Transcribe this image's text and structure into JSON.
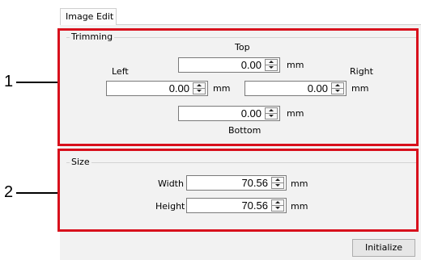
{
  "tab": {
    "label": "Image Edit"
  },
  "callouts": {
    "one": "1",
    "two": "2"
  },
  "trimming": {
    "title": "Trimming",
    "top": {
      "label": "Top",
      "value": "0.00",
      "unit": "mm"
    },
    "left": {
      "label": "Left",
      "value": "0.00",
      "unit": "mm"
    },
    "right": {
      "label": "Right",
      "value": "0.00",
      "unit": "mm"
    },
    "bottom": {
      "label": "Bottom",
      "value": "0.00",
      "unit": "mm"
    }
  },
  "size": {
    "title": "Size",
    "width": {
      "label": "Width",
      "value": "70.56",
      "unit": "mm"
    },
    "height": {
      "label": "Height",
      "value": "70.56",
      "unit": "mm"
    }
  },
  "buttons": {
    "initialize": "Initialize"
  },
  "colors": {
    "callout": "#d8101c",
    "panel": "#f2f2f2"
  },
  "icons": {
    "spin_up": "triangle-up-icon",
    "spin_down": "triangle-down-icon"
  }
}
